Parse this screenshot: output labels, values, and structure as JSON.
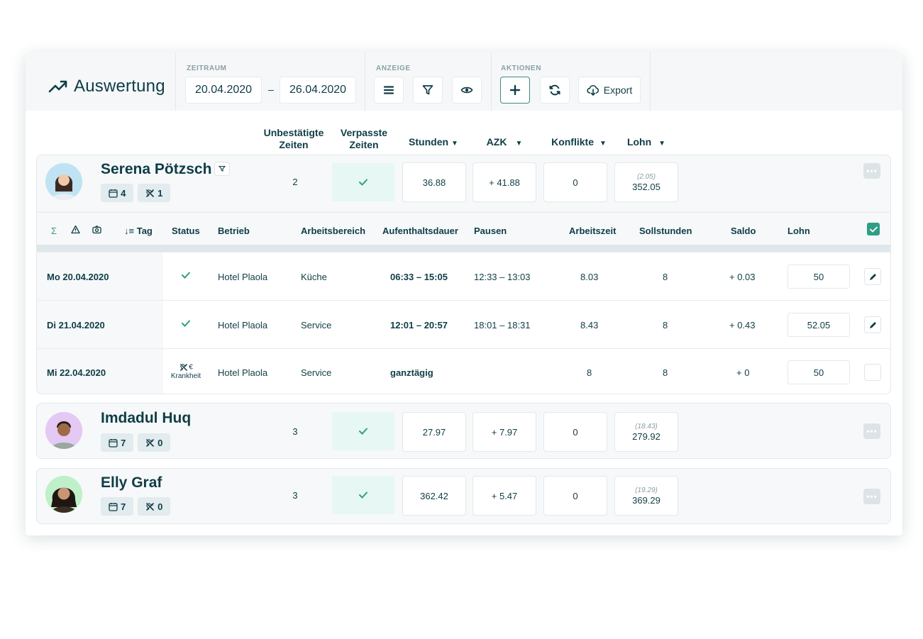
{
  "header": {
    "title": "Auswertung",
    "zeitraum": {
      "label": "ZEITRAUM",
      "from": "20.04.2020",
      "separator": "–",
      "to": "26.04.2020"
    },
    "anzeige": {
      "label": "ANZEIGE"
    },
    "aktionen": {
      "label": "AKTIONEN",
      "export_label": "Export"
    }
  },
  "columns": {
    "unbestaetigte": [
      "Unbestätigte",
      "Zeiten"
    ],
    "verpasste": [
      "Verpasste",
      "Zeiten"
    ],
    "stunden": "Stunden",
    "azk": "AZK",
    "konflikte": "Konflikte",
    "lohn": "Lohn"
  },
  "employees": [
    {
      "name": "Serena Pötzsch",
      "shifts": "4",
      "absences": "1",
      "unconfirmed": "2",
      "stunden": "36.88",
      "azk": "+ 41.88",
      "konflikte": "0",
      "lohn_sub": "(2.05)",
      "lohn": "352.05"
    },
    {
      "name": "Imdadul Huq",
      "shifts": "7",
      "absences": "0",
      "unconfirmed": "3",
      "stunden": "27.97",
      "azk": "+ 7.97",
      "konflikte": "0",
      "lohn_sub": "(18.43)",
      "lohn": "279.92"
    },
    {
      "name": "Elly Graf",
      "shifts": "7",
      "absences": "0",
      "unconfirmed": "3",
      "stunden": "362.42",
      "azk": "+ 5.47",
      "konflikte": "0",
      "lohn_sub": "(19.29)",
      "lohn": "369.29"
    }
  ],
  "detail": {
    "headers": {
      "sigma": "Σ",
      "tag": "Tag",
      "status": "Status",
      "betrieb": "Betrieb",
      "arbeitsbereich": "Arbeitsbereich",
      "aufenthaltsdauer": "Aufenthaltsdauer",
      "pausen": "Pausen",
      "arbeitszeit": "Arbeitszeit",
      "sollstunden": "Sollstunden",
      "saldo": "Saldo",
      "lohn": "Lohn"
    },
    "rows": [
      {
        "tag": "Mo 20.04.2020",
        "betrieb": "Hotel Plaola",
        "bereich": "Küche",
        "dauer": "06:33 – 15:05",
        "pausen": "12:33 – 13:03",
        "arbeitszeit": "8.03",
        "soll": "8",
        "saldo": "+ 0.03",
        "lohn": "50"
      },
      {
        "tag": "Di 21.04.2020",
        "betrieb": "Hotel Plaola",
        "bereich": "Service",
        "dauer": "12:01 – 20:57",
        "pausen": "18:01 – 18:31",
        "arbeitszeit": "8.43",
        "soll": "8",
        "saldo": "+ 0.43",
        "lohn": "52.05"
      },
      {
        "tag": "Mi 22.04.2020",
        "status_text": "Krankheit",
        "status_symbol": "€",
        "betrieb": "Hotel Plaola",
        "bereich": "Service",
        "dauer": "ganztägig",
        "pausen": "",
        "arbeitszeit": "8",
        "soll": "8",
        "saldo": "+ 0",
        "lohn": "50"
      }
    ]
  },
  "colors": {
    "accent": "#2e9e85",
    "text": "#0f3d46",
    "muted": "#8aa0a6",
    "highlight": "#e7f7f3"
  }
}
